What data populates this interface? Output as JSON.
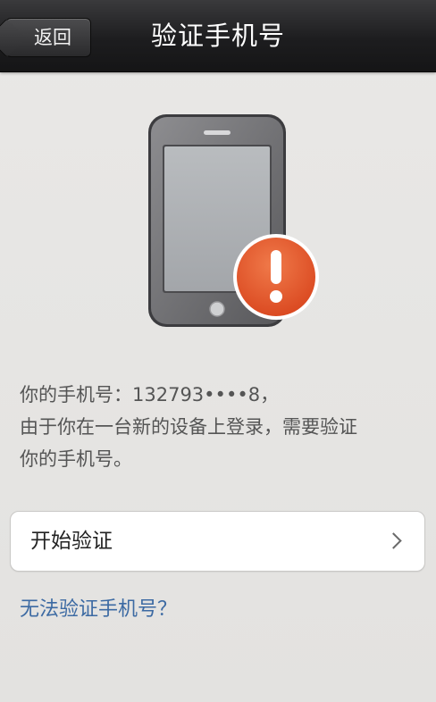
{
  "header": {
    "back_label": "返回",
    "title": "验证手机号"
  },
  "illustration": {
    "icon": "phone-with-warning-icon",
    "badge_color": "#e5562a"
  },
  "message": {
    "line1": "你的手机号：132793••••8，",
    "line2": "由于你在一台新的设备上登录，需要验证",
    "line3": "你的手机号。"
  },
  "actions": {
    "start_label": "开始验证",
    "help_link": "无法验证手机号？"
  },
  "colors": {
    "link": "#3c6aa3",
    "header": "#1d1d1f"
  }
}
